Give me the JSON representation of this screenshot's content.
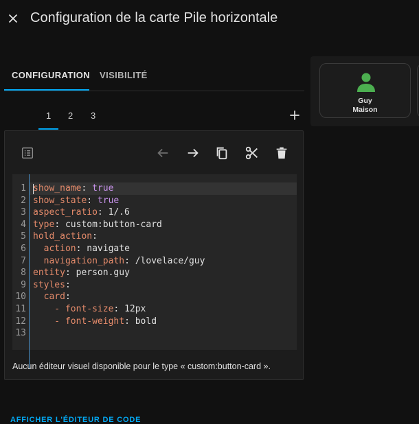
{
  "header": {
    "title": "Configuration de la carte Pile horizontale",
    "close_icon": "close-icon"
  },
  "tabs": [
    {
      "label": "CONFIGURATION",
      "active": true
    },
    {
      "label": "VISIBILITÉ",
      "active": false
    }
  ],
  "subtabs": [
    {
      "label": "1",
      "active": true
    },
    {
      "label": "2",
      "active": false
    },
    {
      "label": "3",
      "active": false
    }
  ],
  "toolbar": {
    "icons": [
      "list-icon",
      "arrow-left-icon",
      "arrow-right-icon",
      "copy-icon",
      "scissors-icon",
      "delete-icon"
    ]
  },
  "editor": {
    "line_numbers": [
      "1",
      "2",
      "3",
      "4",
      "5",
      "6",
      "7",
      "8",
      "9",
      "10",
      "11",
      "12",
      "13"
    ],
    "lines": [
      {
        "key": "show_name",
        "sep": ": ",
        "value": "true",
        "value_type": "bool"
      },
      {
        "key": "show_state",
        "sep": ": ",
        "value": "true",
        "value_type": "bool"
      },
      {
        "key": "aspect_ratio",
        "sep": ": ",
        "value": "1/.6"
      },
      {
        "key": "type",
        "sep": ": ",
        "value": "custom:button-card"
      },
      {
        "key": "hold_action",
        "sep": ":",
        "value": ""
      },
      {
        "indent": "  ",
        "key": "action",
        "sep": ": ",
        "value": "navigate"
      },
      {
        "indent": "  ",
        "key": "navigation_path",
        "sep": ": ",
        "value": "/lovelace/guy"
      },
      {
        "key": "entity",
        "sep": ": ",
        "value": "person.guy"
      },
      {
        "key": "styles",
        "sep": ":",
        "value": ""
      },
      {
        "indent": "  ",
        "key": "card",
        "sep": ":",
        "value": ""
      },
      {
        "indent": "    - ",
        "key": "font-size",
        "sep": ": ",
        "value": "12px"
      },
      {
        "indent": "    - ",
        "key": "font-weight",
        "sep": ": ",
        "value": "bold"
      },
      {
        "key": "",
        "sep": "",
        "value": ""
      }
    ]
  },
  "note": "Aucun éditeur visuel disponible pour le type « custom:button-card ».",
  "show_code_label": "AFFICHER L'ÉDITEUR DE CODE",
  "preview": {
    "card_name_line1": "Guy",
    "card_name_line2": "Maison",
    "icon": "person-icon",
    "icon_color": "#4caf50"
  },
  "colors": {
    "accent": "#03a9f4",
    "background": "#111111",
    "yaml_key": "#e58b6b",
    "yaml_bool": "#c792ea"
  }
}
